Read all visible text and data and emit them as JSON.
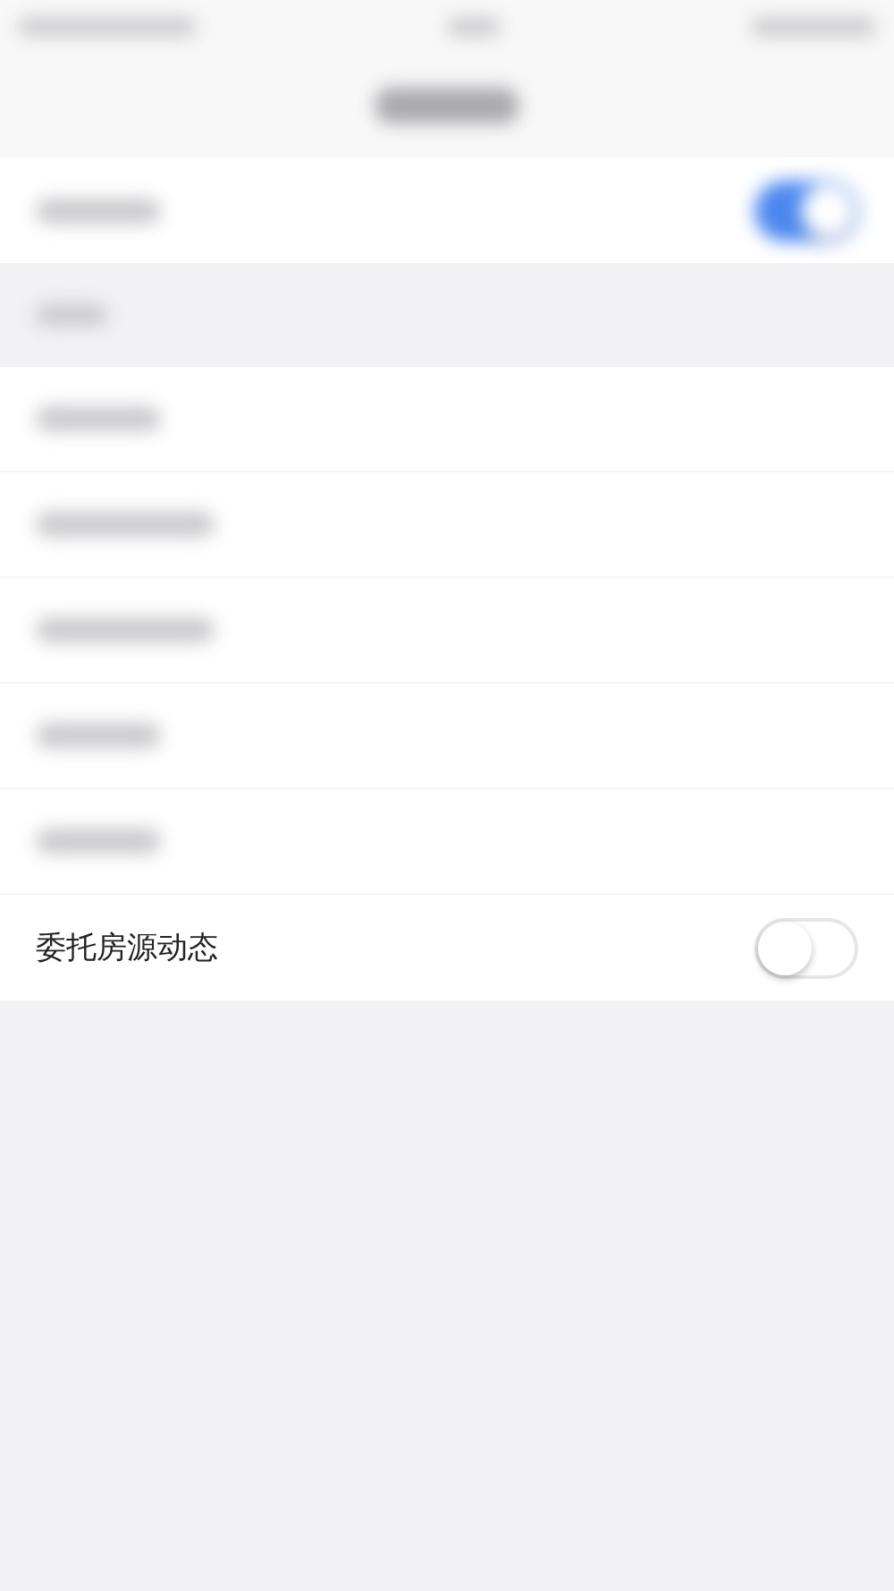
{
  "top_row": {
    "kind": "blurred-switch",
    "on": true
  },
  "section_header": {
    "kind": "blurred"
  },
  "rows": [
    {
      "kind": "blurred"
    },
    {
      "kind": "blurred"
    },
    {
      "kind": "blurred"
    },
    {
      "kind": "blurred"
    },
    {
      "kind": "blurred"
    },
    {
      "kind": "switch",
      "label": "委托房源动态",
      "on": false
    }
  ]
}
